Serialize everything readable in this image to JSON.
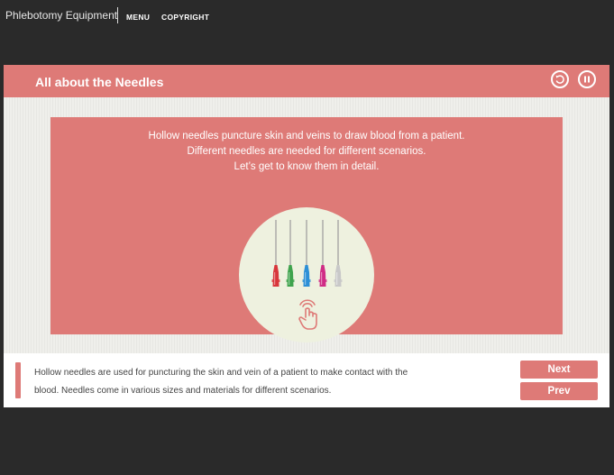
{
  "topbar": {
    "app_title": "Phlebotomy Equipment",
    "menu_label": "MENU",
    "copyright_label": "COPYRIGHT"
  },
  "panel": {
    "title": "All about the Needles",
    "replay_icon": "replay-icon",
    "pause_icon": "pause-icon"
  },
  "card": {
    "intro_line1": "Hollow needles puncture skin and veins to draw blood from a patient.",
    "intro_line2": "Different needles are needed for different scenarios.",
    "intro_line3": "Let’s get to know them in detail.",
    "needle_colors": [
      "#d8363b",
      "#3fa34d",
      "#2c8fd6",
      "#d02c86",
      "#c8c8c8"
    ],
    "hand_icon": "tap-hand-icon"
  },
  "footer": {
    "narration_line1": "Hollow needles are used for puncturing the skin and vein of a patient to make contact with the",
    "narration_line2": "blood. Needles come in various sizes and materials for different scenarios.",
    "next_label": "Next",
    "prev_label": "Prev"
  },
  "colors": {
    "accent": "#de7a77",
    "background": "#2a2a2a",
    "illustration_bg": "#eef1df"
  }
}
